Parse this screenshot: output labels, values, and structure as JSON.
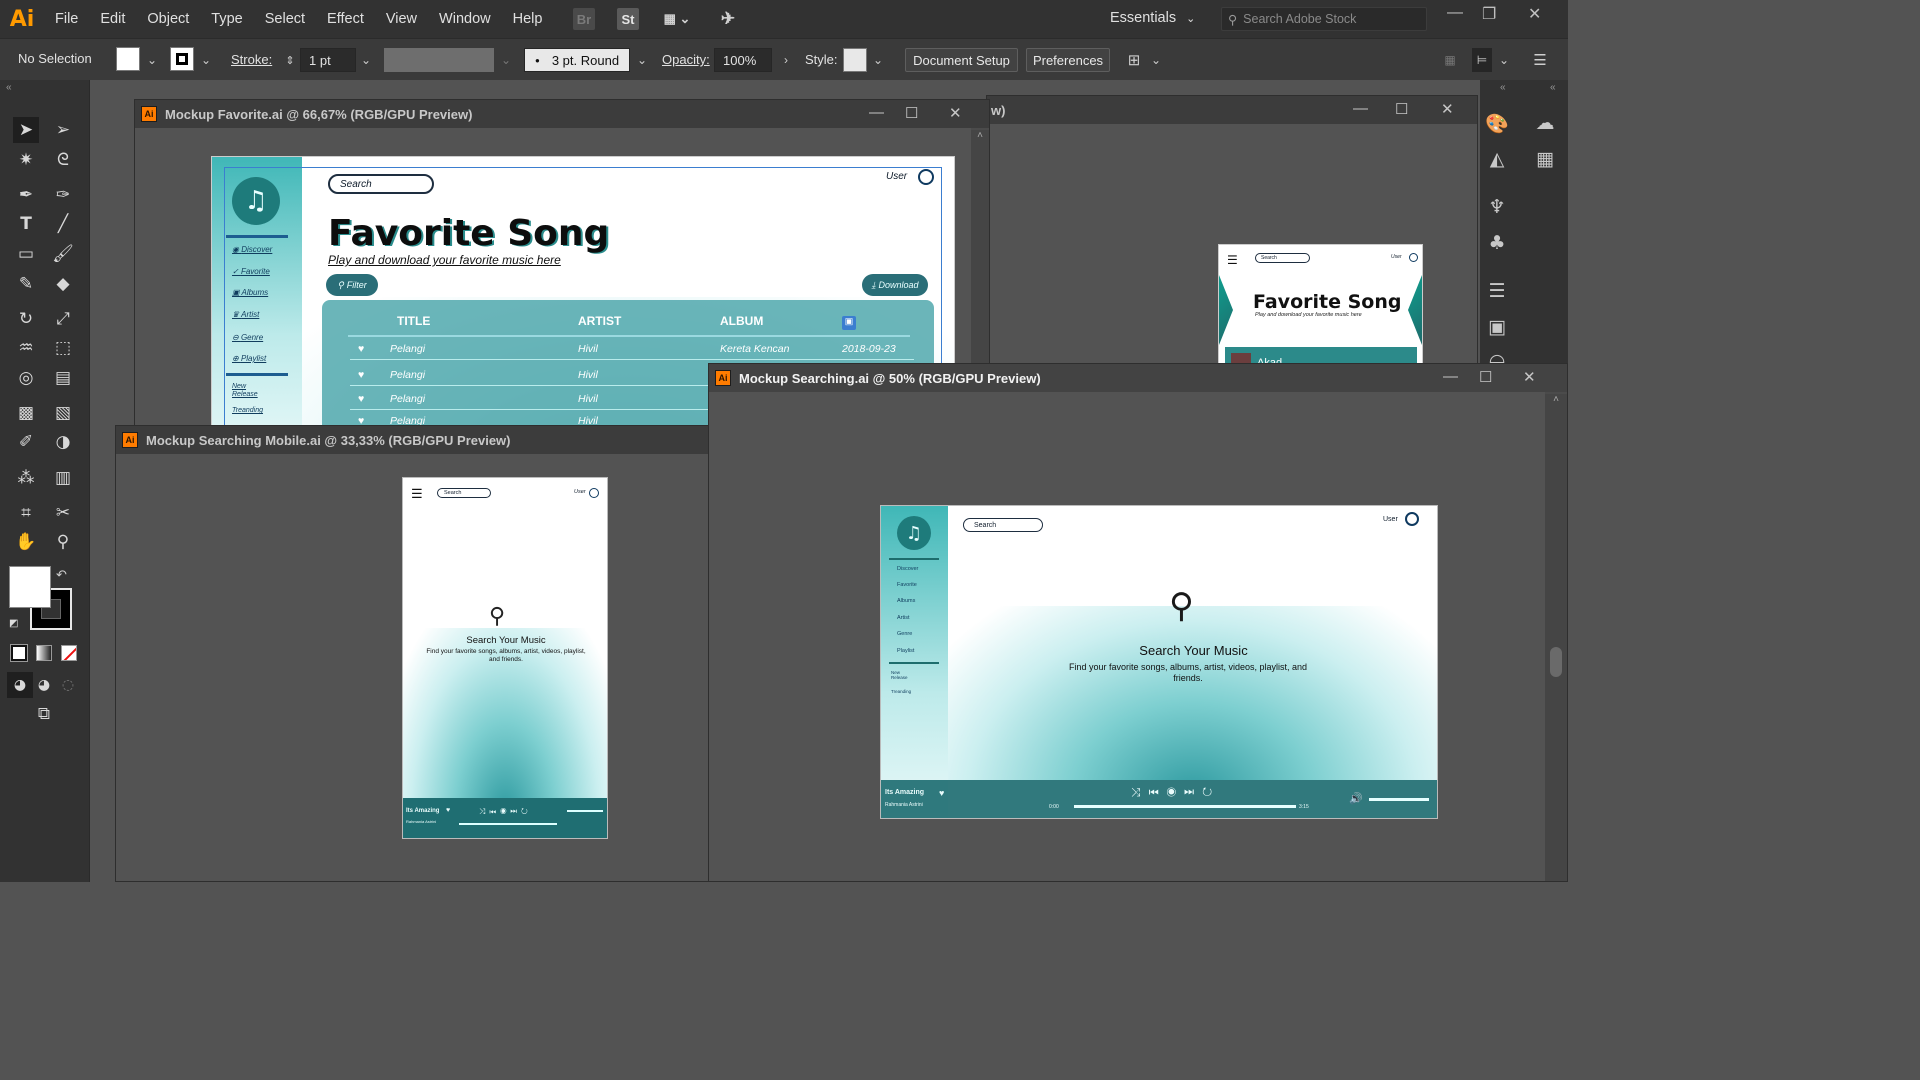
{
  "app": {
    "logo": "Ai",
    "menu": [
      "File",
      "Edit",
      "Object",
      "Type",
      "Select",
      "Effect",
      "View",
      "Window",
      "Help"
    ],
    "bridge_label": "Br",
    "stock_label": "St",
    "workspace": "Essentials",
    "stock_search_placeholder": "Search Adobe Stock"
  },
  "control_bar": {
    "selection": "No Selection",
    "stroke_label": "Stroke:",
    "stroke_value": "1 pt",
    "brush": "3 pt. Round",
    "opacity_label": "Opacity:",
    "opacity_value": "100%",
    "style_label": "Style:",
    "document_setup": "Document Setup",
    "preferences": "Preferences"
  },
  "documents": {
    "favorite": {
      "title": "Mockup Favorite.ai @ 66,67% (RGB/GPU Preview)",
      "search": "Search",
      "user": "User",
      "heading": "Favorite Song",
      "subheading": "Play and download your favorite music here",
      "filter": "Filter",
      "download": "Download",
      "nav": [
        "Discover",
        "Favorite",
        "Albums",
        "Artist",
        "Genre",
        "Playlist"
      ],
      "nav_extra": [
        "New Release",
        "Treanding"
      ],
      "columns": [
        "TITLE",
        "ARTIST",
        "ALBUM"
      ],
      "rows": [
        {
          "title": "Pelangi",
          "artist": "Hivil",
          "album": "Kereta Kencan",
          "date": "2018-09-23"
        },
        {
          "title": "Pelangi",
          "artist": "Hivil",
          "album": "",
          "date": ""
        },
        {
          "title": "Pelangi",
          "artist": "Hivil",
          "album": "",
          "date": ""
        },
        {
          "title": "Pelangi",
          "artist": "Hivil",
          "album": "",
          "date": ""
        }
      ]
    },
    "hidden": {
      "title_suffix": "w)",
      "search": "Search",
      "user": "User",
      "heading": "Favorite Song",
      "subheading": "Play and download your favorite music here",
      "row_title": "Akad"
    },
    "mobile": {
      "title": "Mockup Searching Mobile.ai @ 33,33% (RGB/GPU Preview)",
      "search": "Search",
      "user": "User",
      "heading": "Search Your Music",
      "subheading": "Find your favorite songs, albums, artist, videos, playlist, and friends.",
      "now_playing": "Its Amazing",
      "artist": "Rahmania Astrini"
    },
    "searching": {
      "title": "Mockup Searching.ai @ 50% (RGB/GPU Preview)",
      "search": "Search",
      "user": "User",
      "heading": "Search Your Music",
      "subheading": "Find your favorite songs, albums, artist, videos, playlist, and friends.",
      "nav": [
        "Discover",
        "Favorite",
        "Albums",
        "Artist",
        "Genre",
        "Playlist"
      ],
      "nav_extra": [
        "New Release",
        "Treanding"
      ],
      "now_playing": "Its Amazing",
      "artist": "Rahmania Astrini",
      "time_start": "0:00",
      "time_end": "3:15"
    }
  },
  "colors": {
    "teal_dark": "#1f6e72",
    "teal": "#3fb7b7",
    "ai_orange": "#ff9a00"
  }
}
